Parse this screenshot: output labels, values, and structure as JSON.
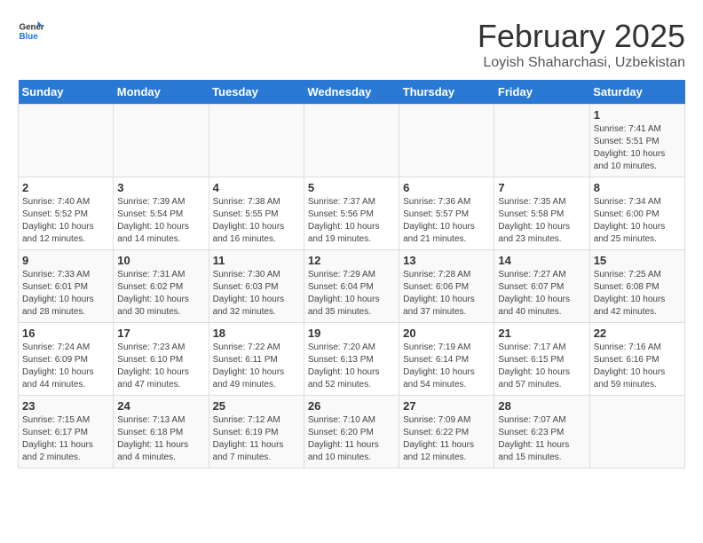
{
  "header": {
    "logo_line1": "General",
    "logo_line2": "Blue",
    "title": "February 2025",
    "subtitle": "Loyish Shaharchasi, Uzbekistan"
  },
  "days_of_week": [
    "Sunday",
    "Monday",
    "Tuesday",
    "Wednesday",
    "Thursday",
    "Friday",
    "Saturday"
  ],
  "weeks": [
    [
      {
        "day": "",
        "info": ""
      },
      {
        "day": "",
        "info": ""
      },
      {
        "day": "",
        "info": ""
      },
      {
        "day": "",
        "info": ""
      },
      {
        "day": "",
        "info": ""
      },
      {
        "day": "",
        "info": ""
      },
      {
        "day": "1",
        "info": "Sunrise: 7:41 AM\nSunset: 5:51 PM\nDaylight: 10 hours and 10 minutes."
      }
    ],
    [
      {
        "day": "2",
        "info": "Sunrise: 7:40 AM\nSunset: 5:52 PM\nDaylight: 10 hours and 12 minutes."
      },
      {
        "day": "3",
        "info": "Sunrise: 7:39 AM\nSunset: 5:54 PM\nDaylight: 10 hours and 14 minutes."
      },
      {
        "day": "4",
        "info": "Sunrise: 7:38 AM\nSunset: 5:55 PM\nDaylight: 10 hours and 16 minutes."
      },
      {
        "day": "5",
        "info": "Sunrise: 7:37 AM\nSunset: 5:56 PM\nDaylight: 10 hours and 19 minutes."
      },
      {
        "day": "6",
        "info": "Sunrise: 7:36 AM\nSunset: 5:57 PM\nDaylight: 10 hours and 21 minutes."
      },
      {
        "day": "7",
        "info": "Sunrise: 7:35 AM\nSunset: 5:58 PM\nDaylight: 10 hours and 23 minutes."
      },
      {
        "day": "8",
        "info": "Sunrise: 7:34 AM\nSunset: 6:00 PM\nDaylight: 10 hours and 25 minutes."
      }
    ],
    [
      {
        "day": "9",
        "info": "Sunrise: 7:33 AM\nSunset: 6:01 PM\nDaylight: 10 hours and 28 minutes."
      },
      {
        "day": "10",
        "info": "Sunrise: 7:31 AM\nSunset: 6:02 PM\nDaylight: 10 hours and 30 minutes."
      },
      {
        "day": "11",
        "info": "Sunrise: 7:30 AM\nSunset: 6:03 PM\nDaylight: 10 hours and 32 minutes."
      },
      {
        "day": "12",
        "info": "Sunrise: 7:29 AM\nSunset: 6:04 PM\nDaylight: 10 hours and 35 minutes."
      },
      {
        "day": "13",
        "info": "Sunrise: 7:28 AM\nSunset: 6:06 PM\nDaylight: 10 hours and 37 minutes."
      },
      {
        "day": "14",
        "info": "Sunrise: 7:27 AM\nSunset: 6:07 PM\nDaylight: 10 hours and 40 minutes."
      },
      {
        "day": "15",
        "info": "Sunrise: 7:25 AM\nSunset: 6:08 PM\nDaylight: 10 hours and 42 minutes."
      }
    ],
    [
      {
        "day": "16",
        "info": "Sunrise: 7:24 AM\nSunset: 6:09 PM\nDaylight: 10 hours and 44 minutes."
      },
      {
        "day": "17",
        "info": "Sunrise: 7:23 AM\nSunset: 6:10 PM\nDaylight: 10 hours and 47 minutes."
      },
      {
        "day": "18",
        "info": "Sunrise: 7:22 AM\nSunset: 6:11 PM\nDaylight: 10 hours and 49 minutes."
      },
      {
        "day": "19",
        "info": "Sunrise: 7:20 AM\nSunset: 6:13 PM\nDaylight: 10 hours and 52 minutes."
      },
      {
        "day": "20",
        "info": "Sunrise: 7:19 AM\nSunset: 6:14 PM\nDaylight: 10 hours and 54 minutes."
      },
      {
        "day": "21",
        "info": "Sunrise: 7:17 AM\nSunset: 6:15 PM\nDaylight: 10 hours and 57 minutes."
      },
      {
        "day": "22",
        "info": "Sunrise: 7:16 AM\nSunset: 6:16 PM\nDaylight: 10 hours and 59 minutes."
      }
    ],
    [
      {
        "day": "23",
        "info": "Sunrise: 7:15 AM\nSunset: 6:17 PM\nDaylight: 11 hours and 2 minutes."
      },
      {
        "day": "24",
        "info": "Sunrise: 7:13 AM\nSunset: 6:18 PM\nDaylight: 11 hours and 4 minutes."
      },
      {
        "day": "25",
        "info": "Sunrise: 7:12 AM\nSunset: 6:19 PM\nDaylight: 11 hours and 7 minutes."
      },
      {
        "day": "26",
        "info": "Sunrise: 7:10 AM\nSunset: 6:20 PM\nDaylight: 11 hours and 10 minutes."
      },
      {
        "day": "27",
        "info": "Sunrise: 7:09 AM\nSunset: 6:22 PM\nDaylight: 11 hours and 12 minutes."
      },
      {
        "day": "28",
        "info": "Sunrise: 7:07 AM\nSunset: 6:23 PM\nDaylight: 11 hours and 15 minutes."
      },
      {
        "day": "",
        "info": ""
      }
    ]
  ]
}
